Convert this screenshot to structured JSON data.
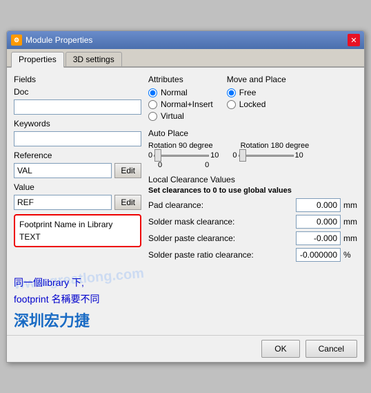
{
  "window": {
    "title": "Module Properties",
    "icon": "M"
  },
  "tabs": [
    {
      "label": "Properties",
      "active": true
    },
    {
      "label": "3D settings",
      "active": false
    }
  ],
  "fields": {
    "section_label": "Fields",
    "doc_label": "Doc",
    "doc_value": "",
    "keywords_label": "Keywords",
    "keywords_value": "",
    "reference_label": "Reference",
    "reference_value": "VAL",
    "edit_btn1": "Edit",
    "value_label": "Value",
    "value_value": "REF",
    "edit_btn2": "Edit",
    "footprint_label": "Footprint Name in Library",
    "footprint_value": "TEXT"
  },
  "attributes": {
    "section_label": "Attributes",
    "options": [
      {
        "label": "Normal",
        "checked": true
      },
      {
        "label": "Normal+Insert",
        "checked": false
      },
      {
        "label": "Virtual",
        "checked": false
      }
    ]
  },
  "move_and_place": {
    "section_label": "Move and Place",
    "options": [
      {
        "label": "Free",
        "checked": true
      },
      {
        "label": "Locked",
        "checked": false
      }
    ]
  },
  "auto_place": {
    "section_label": "Auto Place",
    "rotation90_label": "Rotation 90 degree",
    "rotation180_label": "Rotation 180 degree",
    "rotation90_min": "0",
    "rotation90_max": "10",
    "rotation90_value": 0,
    "rotation180_min": "0",
    "rotation180_max": "10",
    "rotation180_value": 0
  },
  "local_clearance": {
    "section_label": "Local Clearance Values",
    "subtitle": "Set clearances to 0 to use global values",
    "rows": [
      {
        "label": "Pad clearance:",
        "value": "0.000",
        "unit": "mm"
      },
      {
        "label": "Solder mask clearance:",
        "value": "0.000",
        "unit": "mm"
      },
      {
        "label": "Solder paste clearance:",
        "value": "-0.000",
        "unit": "mm"
      },
      {
        "label": "Solder paste ratio clearance:",
        "value": "-0.000000",
        "unit": "%"
      }
    ]
  },
  "annotation": {
    "line1": "同一個library 下,",
    "line2": "footprint 名稱要不同"
  },
  "brand": {
    "text": "深圳宏力捷"
  },
  "footer": {
    "ok_label": "OK",
    "cancel_label": "Cancel"
  }
}
